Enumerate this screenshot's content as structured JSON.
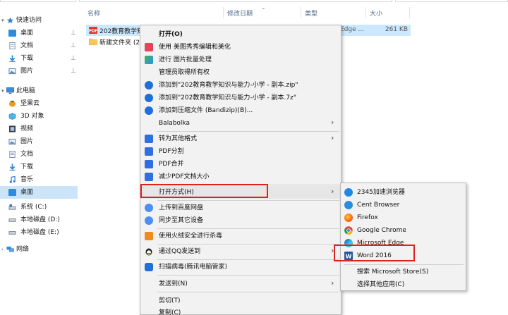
{
  "columns": {
    "name": "名称",
    "date": "修改日期",
    "type": "类型",
    "size": "大小"
  },
  "nav": {
    "quick_access": "快速访问",
    "pinned": [
      {
        "label": "桌面",
        "icon": "folder-blue-icon"
      },
      {
        "label": "文档",
        "icon": "document-icon"
      },
      {
        "label": "下载",
        "icon": "download-arrow-icon"
      },
      {
        "label": "图片",
        "icon": "pictures-icon"
      }
    ],
    "pin_glyph": "📌",
    "this_pc": "此电脑",
    "pc_items": [
      {
        "label": "坚果云",
        "icon": "nutstore-icon"
      },
      {
        "label": "3D 对象",
        "icon": "3d-objects-icon"
      },
      {
        "label": "视频",
        "icon": "video-icon"
      },
      {
        "label": "图片",
        "icon": "pictures-icon"
      },
      {
        "label": "文档",
        "icon": "document-icon"
      },
      {
        "label": "下载",
        "icon": "download-arrow-icon"
      },
      {
        "label": "音乐",
        "icon": "music-icon"
      },
      {
        "label": "桌面",
        "icon": "folder-blue-icon",
        "selected": true
      },
      {
        "label": "系统 (C:)",
        "icon": "system-drive-icon"
      },
      {
        "label": "本地磁盘 (D:)",
        "icon": "drive-icon"
      },
      {
        "label": "本地磁盘 (E:)",
        "icon": "drive-icon"
      }
    ],
    "network": "网络"
  },
  "files": [
    {
      "name": "202教育教学知",
      "type": "Edge ...",
      "size": "261 KB",
      "icon": "pdf-file-icon",
      "selected": true
    },
    {
      "name": "新建文件夹 (2",
      "type": "",
      "size": "",
      "icon": "folder-icon",
      "selected": false
    }
  ],
  "context_menu": {
    "items": [
      {
        "label": "打开(O)",
        "icon": "",
        "bold": true
      },
      {
        "label": "使用 美图秀秀编辑和美化",
        "icon": "meitu-icon"
      },
      {
        "label": "进行 图片批量处理",
        "icon": "batch-image-icon"
      },
      {
        "label": "管理员取得所有权",
        "icon": ""
      },
      {
        "label": "添加到\"202教育教学知识与能力-小学 - 副本.zip\"",
        "icon": "bandizip-icon"
      },
      {
        "label": "添加到\"202教育教学知识与能力-小学 - 副本.7z\"",
        "icon": "bandizip-icon"
      },
      {
        "label": "添加到压缩文件 (Bandizip)(B)...",
        "icon": "bandizip-icon"
      },
      {
        "label": "Balabolka",
        "icon": "",
        "submenu": true
      },
      {
        "label": "转为其他格式",
        "icon": "convert-format-icon",
        "submenu": true
      },
      {
        "label": "PDF分割",
        "icon": "pdf-split-icon"
      },
      {
        "label": "PDF合并",
        "icon": "pdf-merge-icon"
      },
      {
        "label": "减少PDF文档大小",
        "icon": "pdf-compress-icon"
      },
      {
        "label": "打开方式(H)",
        "icon": "",
        "submenu": true
      },
      {
        "label": "上传到百度网盘",
        "icon": "baidu-netdisk-icon"
      },
      {
        "label": "同步至其它设备",
        "icon": "baidu-sync-icon"
      },
      {
        "label": "使用火绒安全进行杀毒",
        "icon": "huorong-icon"
      },
      {
        "label": "通过QQ发送到",
        "icon": "qq-penguin-icon",
        "submenu": true
      },
      {
        "label": "扫描病毒(腾讯电脑管家)",
        "icon": "tencent-guard-icon"
      },
      {
        "label": "发送到(N)",
        "icon": "",
        "submenu": true
      },
      {
        "label": "剪切(T)",
        "icon": ""
      },
      {
        "label": "复制(C)",
        "icon": ""
      }
    ],
    "arrow": "›"
  },
  "open_with": {
    "apps": [
      {
        "label": "2345加速浏览器",
        "icon": "2345-browser-icon"
      },
      {
        "label": "Cent Browser",
        "icon": "cent-browser-icon"
      },
      {
        "label": "Firefox",
        "icon": "firefox-icon"
      },
      {
        "label": "Google Chrome",
        "icon": "chrome-icon"
      },
      {
        "label": "Microsoft Edge",
        "icon": "edge-icon"
      },
      {
        "label": "Word 2016",
        "icon": "word-icon"
      }
    ],
    "store": "搜索 Microsoft Store(S)",
    "other": "选择其他应用(C)"
  },
  "colors": {
    "highlight_box": "#e0211d",
    "selection": "#cce8ff",
    "nav_selection": "#cce4f7",
    "menu_bg": "#f2f2f2"
  }
}
